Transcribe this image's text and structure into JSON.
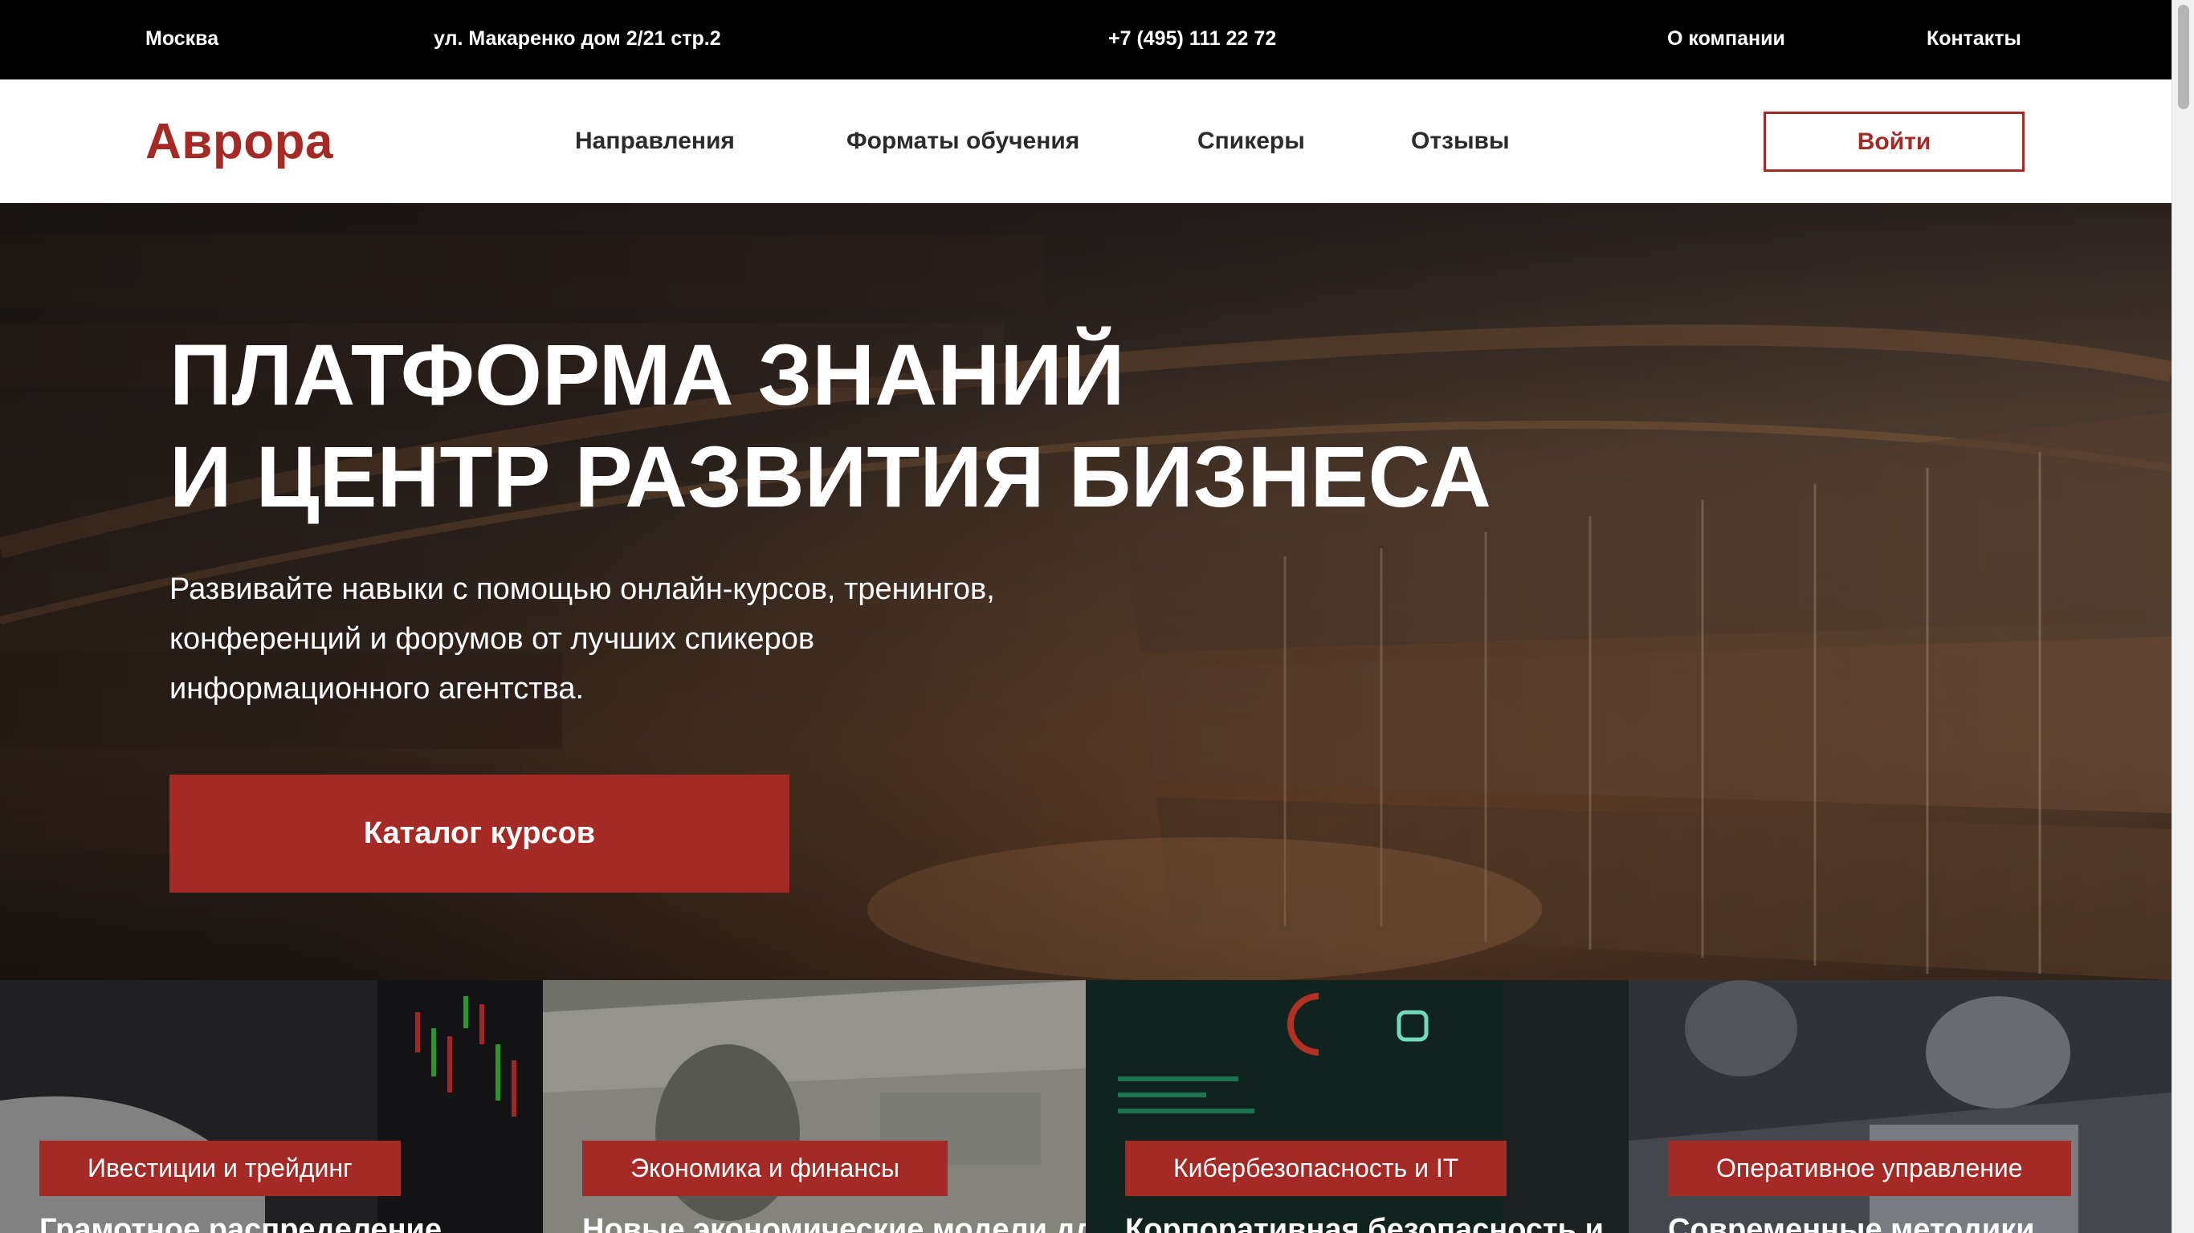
{
  "topbar": {
    "city": "Москва",
    "address": "ул. Макаренко дом 2/21 стр.2",
    "phone": "+7 (495) 111 22 72",
    "about": "О компании",
    "contacts": "Контакты"
  },
  "header": {
    "logo": "Аврора",
    "nav": [
      "Направления",
      "Форматы обучения",
      "Спикеры",
      "Отзывы"
    ],
    "login": "Войти"
  },
  "hero": {
    "title_line1": "ПЛАТФОРМА ЗНАНИЙ",
    "title_line2": "И ЦЕНТР РАЗВИТИЯ БИЗНЕСА",
    "subtitle_line1": "Развивайте навыки с помощью онлайн-курсов, тренингов,",
    "subtitle_line2": "конференций и форумов от лучших спикеров",
    "subtitle_line3": "информационного агентства.",
    "cta": "Каталог курсов"
  },
  "cards": [
    {
      "tag": "Ивестиции и трейдинг",
      "desc": "Грамотное распределение"
    },
    {
      "tag": "Экономика и финансы",
      "desc": "Новые экономические модели для"
    },
    {
      "tag": "Кибербезопасность и IT",
      "desc": "Корпоративная безопасность и"
    },
    {
      "tag": "Оперативное управление",
      "desc": "Современные методики"
    }
  ],
  "colors": {
    "accent": "#a52a25",
    "topbar_bg": "#000000",
    "header_bg": "#ffffff"
  }
}
